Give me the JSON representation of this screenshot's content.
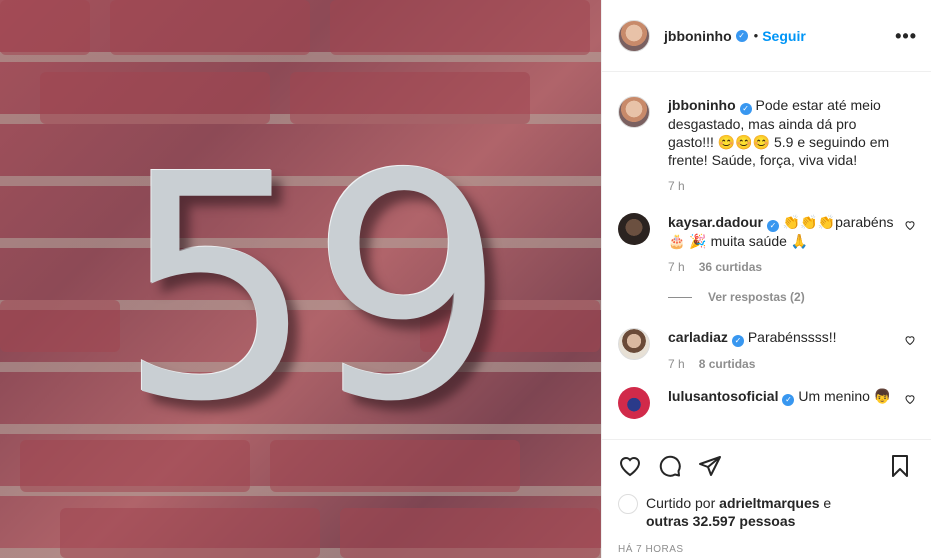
{
  "header": {
    "username": "jbboninho",
    "dot": "•",
    "follow_label": "Seguir",
    "more_label": "•••"
  },
  "caption": {
    "username": "jbboninho",
    "text": "Pode estar até meio desgastado, mas ainda dá pro gasto!!! 😊😊😊 5.9 e seguindo em frente! Saúde, força, viva vida!",
    "time": "7 h"
  },
  "photo": {
    "number_text": "59"
  },
  "comments": [
    {
      "username": "kaysar.dadour",
      "text": "👏👏👏parabéns 🎂 🎉 muita saúde 🙏",
      "time": "7 h",
      "likes": "36 curtidas",
      "replies": "Ver respostas (2)"
    },
    {
      "username": "carladiaz",
      "text": "Parabénssss!!",
      "time": "7 h",
      "likes": "8 curtidas"
    },
    {
      "username": "lulusantosoficial",
      "text": "Um menino 👦"
    }
  ],
  "footer": {
    "liked_by_prefix": "Curtido por",
    "liked_by_user": "adrieltmarques",
    "liked_by_suffix": "e",
    "others": "outras 32.597 pessoas",
    "time_ago": "HÁ 7 HORAS"
  },
  "icons": [
    "heart-icon",
    "comment-icon",
    "share-icon",
    "bookmark-icon",
    "verified-icon",
    "more-icon"
  ],
  "colors": {
    "accent": "#0095f6",
    "verified": "#3897f0",
    "muted": "#8e8e8e"
  }
}
